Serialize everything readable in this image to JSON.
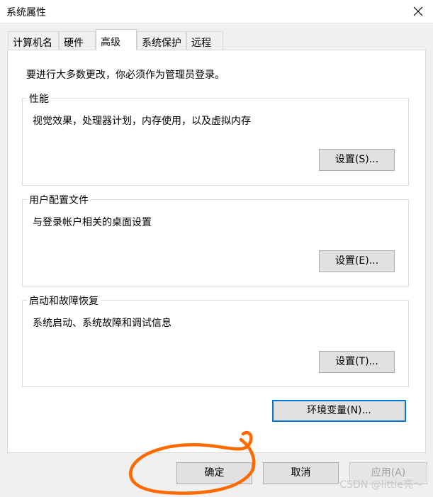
{
  "window": {
    "title": "系统属性"
  },
  "tabs": [
    {
      "label": "计算机名"
    },
    {
      "label": "硬件"
    },
    {
      "label": "高级",
      "active": true
    },
    {
      "label": "系统保护"
    },
    {
      "label": "远程"
    }
  ],
  "notice": "要进行大多数更改，你必须作为管理员登录。",
  "performance": {
    "legend": "性能",
    "description": "视觉效果，处理器计划，内存使用，以及虚拟内存",
    "button": "设置(S)..."
  },
  "user_profiles": {
    "legend": "用户配置文件",
    "description": "与登录帐户相关的桌面设置",
    "button": "设置(E)..."
  },
  "startup_recovery": {
    "legend": "启动和故障恢复",
    "description": "系统启动、系统故障和调试信息",
    "button": "设置(T)..."
  },
  "env_button": "环境变量(N)...",
  "footer": {
    "ok": "确定",
    "cancel": "取消",
    "apply": "应用(A)"
  },
  "watermark": "CSDN @little亮～",
  "colors": {
    "focus_border": "#0078d7",
    "annotation": "#ff6a00"
  }
}
